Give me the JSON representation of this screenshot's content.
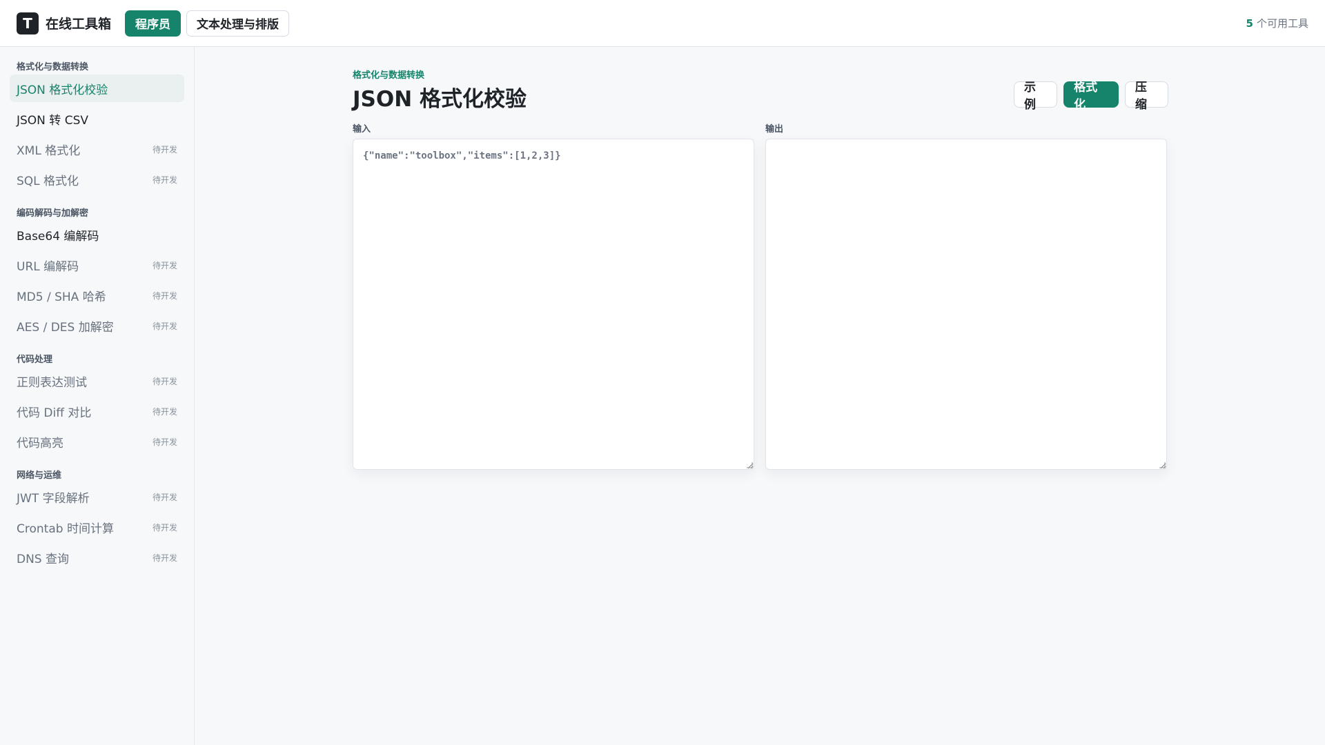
{
  "header": {
    "logo_letter": "T",
    "app_title": "在线工具箱",
    "tabs": [
      {
        "label": "程序员",
        "active": true
      },
      {
        "label": "文本处理与排版",
        "active": false
      }
    ],
    "tool_count": "5",
    "tool_count_suffix": "个可用工具"
  },
  "sidebar": {
    "groups": [
      {
        "title": "格式化与数据转换",
        "items": [
          {
            "label": "JSON 格式化校验",
            "status": "",
            "selected": true
          },
          {
            "label": "JSON 转 CSV",
            "status": ""
          },
          {
            "label": "XML 格式化",
            "status": "待开发"
          },
          {
            "label": "SQL 格式化",
            "status": "待开发"
          }
        ]
      },
      {
        "title": "编码解码与加解密",
        "items": [
          {
            "label": "Base64 编解码",
            "status": ""
          },
          {
            "label": "URL 编解码",
            "status": "待开发"
          },
          {
            "label": "MD5 / SHA 哈希",
            "status": "待开发"
          },
          {
            "label": "AES / DES 加解密",
            "status": "待开发"
          }
        ]
      },
      {
        "title": "代码处理",
        "items": [
          {
            "label": "正则表达测试",
            "status": "待开发"
          },
          {
            "label": "代码 Diff 对比",
            "status": "待开发"
          },
          {
            "label": "代码高亮",
            "status": "待开发"
          }
        ]
      },
      {
        "title": "网络与运维",
        "items": [
          {
            "label": "JWT 字段解析",
            "status": "待开发"
          },
          {
            "label": "Crontab 时间计算",
            "status": "待开发"
          },
          {
            "label": "DNS 查询",
            "status": "待开发"
          }
        ]
      }
    ]
  },
  "main": {
    "breadcrumb": "格式化与数据转换",
    "title": "JSON 格式化校验",
    "actions": {
      "example": "示例",
      "format": "格式化",
      "compress": "压缩"
    },
    "input": {
      "label": "输入",
      "value": "{\"name\":\"toolbox\",\"items\":[1,2,3]}",
      "placeholder": ""
    },
    "output": {
      "label": "输出",
      "value": "",
      "placeholder": ""
    }
  },
  "colors": {
    "accent": "#16836b",
    "text": "#1f2328",
    "muted": "#68717d",
    "background": "#f6f8fa"
  }
}
